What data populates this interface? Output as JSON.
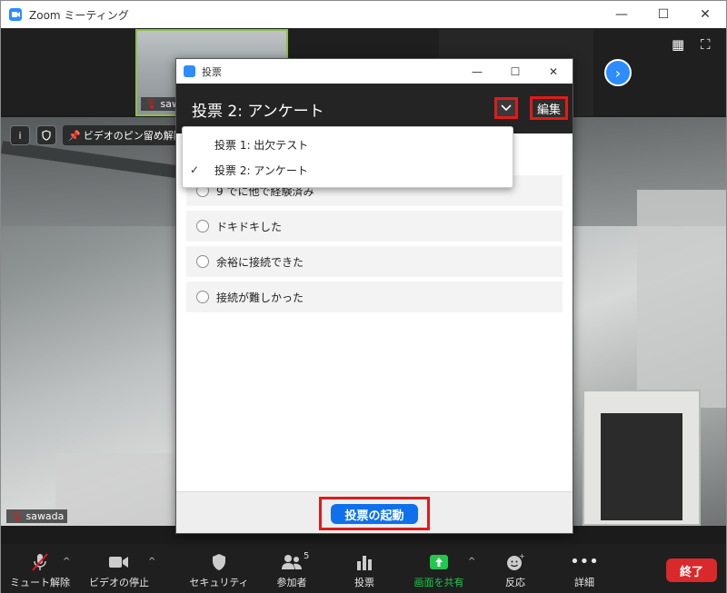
{
  "main_window": {
    "title": "Zoom ミーティング",
    "controls": {
      "minimize": "—",
      "maximize": "☐",
      "close": "✕"
    }
  },
  "video": {
    "self_thumbnail_name": "sawa",
    "pin_video_label": "ビデオのピン留め解除",
    "main_name": "sawada"
  },
  "poll_dialog": {
    "window_title": "投票",
    "controls": {
      "minimize": "—",
      "maximize": "☐",
      "close": "✕"
    },
    "header_title": "投票 2: アンケート",
    "dropdown_icon": "chevron-down-icon",
    "edit_label": "編集",
    "options": [
      "9 でに他で経験済み",
      "ドキドキした",
      "余裕に接続できた",
      "接続が難しかった"
    ],
    "launch_label": "投票の起動",
    "menu": [
      {
        "label": "投票 1: 出欠テスト",
        "checked": false
      },
      {
        "label": "投票 2: アンケート",
        "checked": true
      }
    ],
    "menu_check_glyph": "✓"
  },
  "toolbar": {
    "mute_label": "ミュート解除",
    "video_label": "ビデオの停止",
    "security_label": "セキュリティ",
    "participants_label": "参加者",
    "participants_count": "5",
    "polls_label": "投票",
    "share_label": "画面を共有",
    "reactions_label": "反応",
    "more_label": "詳細",
    "end_label": "終了"
  },
  "colors": {
    "accent_blue": "#0e71eb",
    "highlight_red": "#e21a1a",
    "end_red": "#d9292b",
    "share_green": "#22c74b"
  }
}
